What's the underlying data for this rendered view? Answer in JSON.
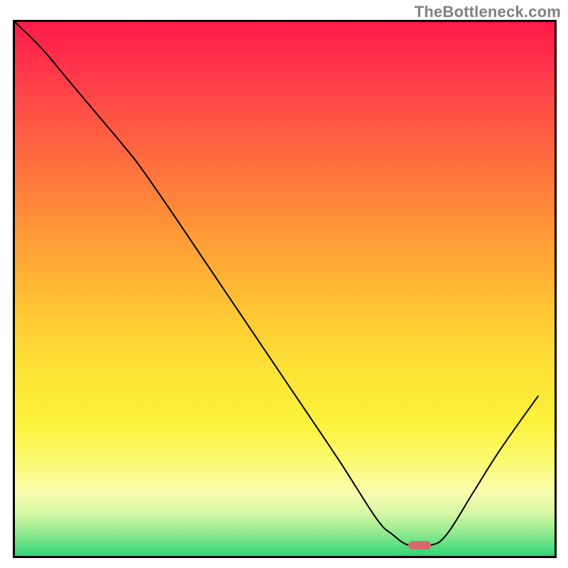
{
  "watermark": "TheBottleneck.com",
  "colors": {
    "frame": "#000000",
    "curve": "#000000",
    "marker": "#d86a6c",
    "gradient_top": "#ff1a47",
    "gradient_bottom": "#2fd475"
  },
  "chart_data": {
    "type": "line",
    "title": "",
    "xlabel": "",
    "ylabel": "",
    "xlim": [
      0,
      100
    ],
    "ylim": [
      0,
      100
    ],
    "grid": false,
    "legend": false,
    "note": "x is normalized horizontal position (0=left, 100=right); y is normalized vertical value (0=bottom/green, 100=top/red). Curve estimated from pixels.",
    "series": [
      {
        "name": "bottleneck-curve",
        "x": [
          0,
          5,
          10,
          15,
          20,
          23.5,
          30,
          40,
          50,
          60,
          67,
          70,
          73,
          77,
          80,
          85,
          90,
          97
        ],
        "y": [
          100,
          95,
          89,
          83,
          77,
          72.5,
          63,
          48,
          33,
          18,
          7,
          4,
          2,
          2,
          4,
          12,
          20,
          30
        ]
      }
    ],
    "marker": {
      "name": "optimal-point",
      "x": 75,
      "y": 2
    }
  }
}
